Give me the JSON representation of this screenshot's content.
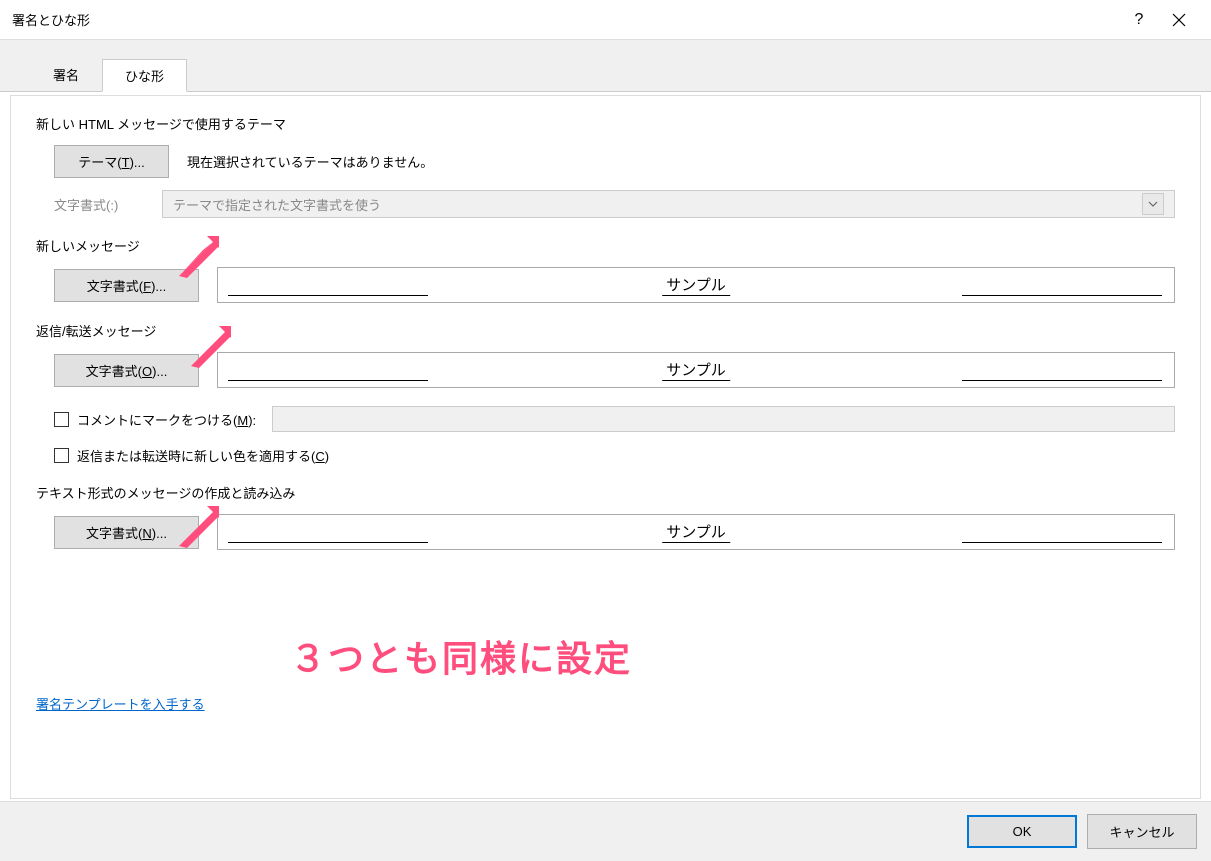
{
  "window": {
    "title": "署名とひな形",
    "help": "?",
    "close": "×"
  },
  "tabs": {
    "signature": "署名",
    "stationery": "ひな形"
  },
  "theme_section": {
    "label": "新しい HTML メッセージで使用するテーマ",
    "button_prefix": "テーマ(",
    "button_key": "T",
    "button_suffix": ")...",
    "status": "現在選択されているテーマはありません。",
    "format_label": "文字書式(:)",
    "dropdown_value": "テーマで指定された文字書式を使う"
  },
  "new_message": {
    "label": "新しいメッセージ",
    "button_prefix": "文字書式(",
    "button_key": "F",
    "button_suffix": ")...",
    "sample": "サンプル"
  },
  "reply_forward": {
    "label": "返信/転送メッセージ",
    "button_prefix": "文字書式(",
    "button_key": "O",
    "button_suffix": ")...",
    "sample": "サンプル",
    "mark_prefix": "コメントにマークをつける(",
    "mark_key": "M",
    "mark_suffix": "):",
    "color_prefix": "返信または転送時に新しい色を適用する(",
    "color_key": "C",
    "color_suffix": ")"
  },
  "plaintext": {
    "label": "テキスト形式のメッセージの作成と読み込み",
    "button_prefix": "文字書式(",
    "button_key": "N",
    "button_suffix": ")...",
    "sample": "サンプル"
  },
  "annotation": "３つとも同様に設定",
  "link_text": "署名テンプレートを入手する",
  "footer": {
    "ok": "OK",
    "cancel": "キャンセル"
  }
}
